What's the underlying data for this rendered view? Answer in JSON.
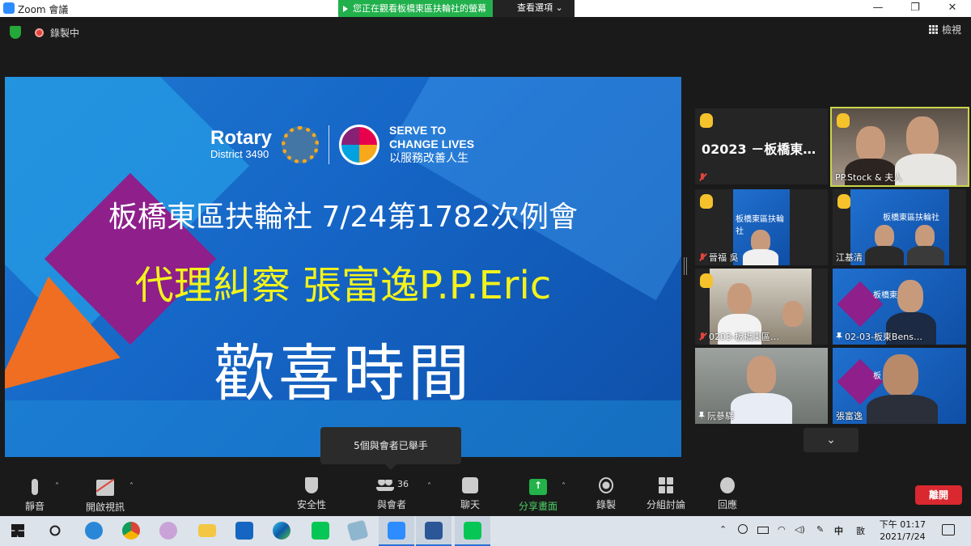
{
  "window": {
    "title": "Zoom 會議",
    "controls": [
      "—",
      "❐",
      "✕"
    ]
  },
  "share_banner": {
    "viewing_text": "您正在觀看板橋東區扶輪社的螢幕",
    "view_options_label": "查看選項 ⌄"
  },
  "status": {
    "recording_label": "錄製中",
    "view_label": "檢視"
  },
  "slide": {
    "rotary_word": "Rotary",
    "district": "District 3490",
    "serve_line1": "SERVE TO",
    "serve_line2": "CHANGE LIVES",
    "serve_line3": "以服務改善人生",
    "line1": "板橋東區扶輪社  7/24第1782次例會",
    "line2": "代理糾察 張富逸P.P.Eric",
    "line3": "歡喜時間"
  },
  "hand_tooltip": "5個與會者已舉手",
  "participants": [
    {
      "name": "02023 －板橋東…",
      "label": "",
      "muted": true,
      "hand": true
    },
    {
      "name": "PP.Stock & 夫人",
      "hand": true
    },
    {
      "name": "晉福 吳",
      "muted": true,
      "hand": true,
      "mini_title": "板橋東區扶輪社"
    },
    {
      "name": "江基清",
      "hand": true,
      "mini_title": "板橋東區扶輪社"
    },
    {
      "name": "0203-板橋東區…",
      "muted": true,
      "hand": true
    },
    {
      "name": "02-03-板東Bens…",
      "pinned": true,
      "mini_title": "板橋東"
    },
    {
      "name": "阮蔘驛",
      "pinned": true
    },
    {
      "name": "張富逸",
      "mini_title": "板"
    }
  ],
  "toolbar": {
    "mute": "靜音",
    "video": "開啟視訊",
    "security": "安全性",
    "participants": "與會者",
    "participant_count": "36",
    "chat": "聊天",
    "share": "分享畫面",
    "record": "錄製",
    "breakout": "分組討論",
    "reactions": "回應",
    "leave": "離開"
  },
  "taskbar": {
    "time": "下午 01:17",
    "date": "2021/7/24",
    "ime": "中",
    "ime2": "㪚"
  },
  "colors": {
    "zoom_blue": "#2d8cff",
    "share_green": "#21b04b",
    "leave_red": "#d9282f",
    "slide_yellow": "#f2f21c"
  }
}
